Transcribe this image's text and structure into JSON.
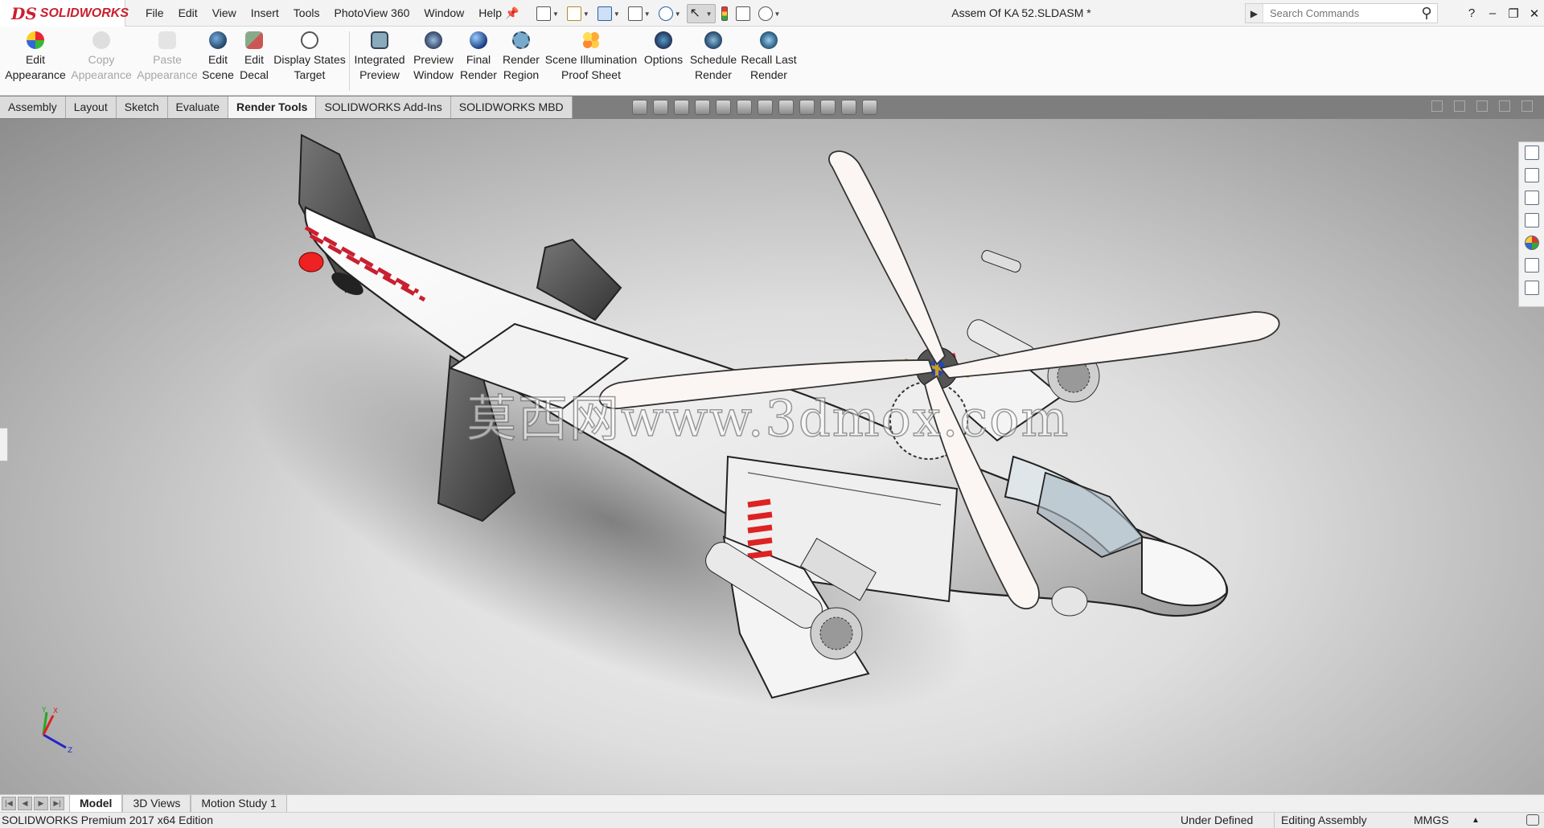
{
  "app": {
    "logo_mark": "DS",
    "logo_text": "SOLIDWORKS",
    "document_title": "Assem Of KA 52.SLDASM *"
  },
  "menu": [
    "File",
    "Edit",
    "View",
    "Insert",
    "Tools",
    "PhotoView 360",
    "Window",
    "Help"
  ],
  "search": {
    "placeholder": "Search Commands"
  },
  "ribbon": {
    "edit_appearance": [
      "Edit",
      "Appearance"
    ],
    "copy_appearance": [
      "Copy",
      "Appearance"
    ],
    "paste_appearance": [
      "Paste",
      "Appearance"
    ],
    "edit_scene": [
      "Edit",
      "Scene"
    ],
    "edit_decal": [
      "Edit",
      "Decal"
    ],
    "display_states": [
      "Display States",
      "Target"
    ],
    "integrated_preview": [
      "Integrated",
      "Preview"
    ],
    "preview_window": [
      "Preview",
      "Window"
    ],
    "final_render": [
      "Final",
      "Render"
    ],
    "render_region": [
      "Render",
      "Region"
    ],
    "scene_illumination": [
      "Scene Illumination",
      "Proof Sheet"
    ],
    "options": [
      "Options"
    ],
    "schedule_render": [
      "Schedule",
      "Render"
    ],
    "recall_last_render": [
      "Recall Last",
      "Render"
    ]
  },
  "tabs": [
    "Assembly",
    "Layout",
    "Sketch",
    "Evaluate",
    "Render Tools",
    "SOLIDWORKS Add-Ins",
    "SOLIDWORKS MBD"
  ],
  "active_tab": "Render Tools",
  "watermark": "莫西网www.3dmox.com",
  "triad": {
    "x": "X",
    "y": "Y",
    "z": "Z"
  },
  "bottom_tabs": [
    "Model",
    "3D Views",
    "Motion Study 1"
  ],
  "status": {
    "product": "SOLIDWORKS Premium 2017 x64 Edition",
    "definition": "Under Defined",
    "mode": "Editing Assembly",
    "units": "MMGS"
  },
  "colors": {
    "brand": "#c8202f",
    "accent": "#1a6fc4",
    "tab_bar": "#7e7e7e"
  }
}
